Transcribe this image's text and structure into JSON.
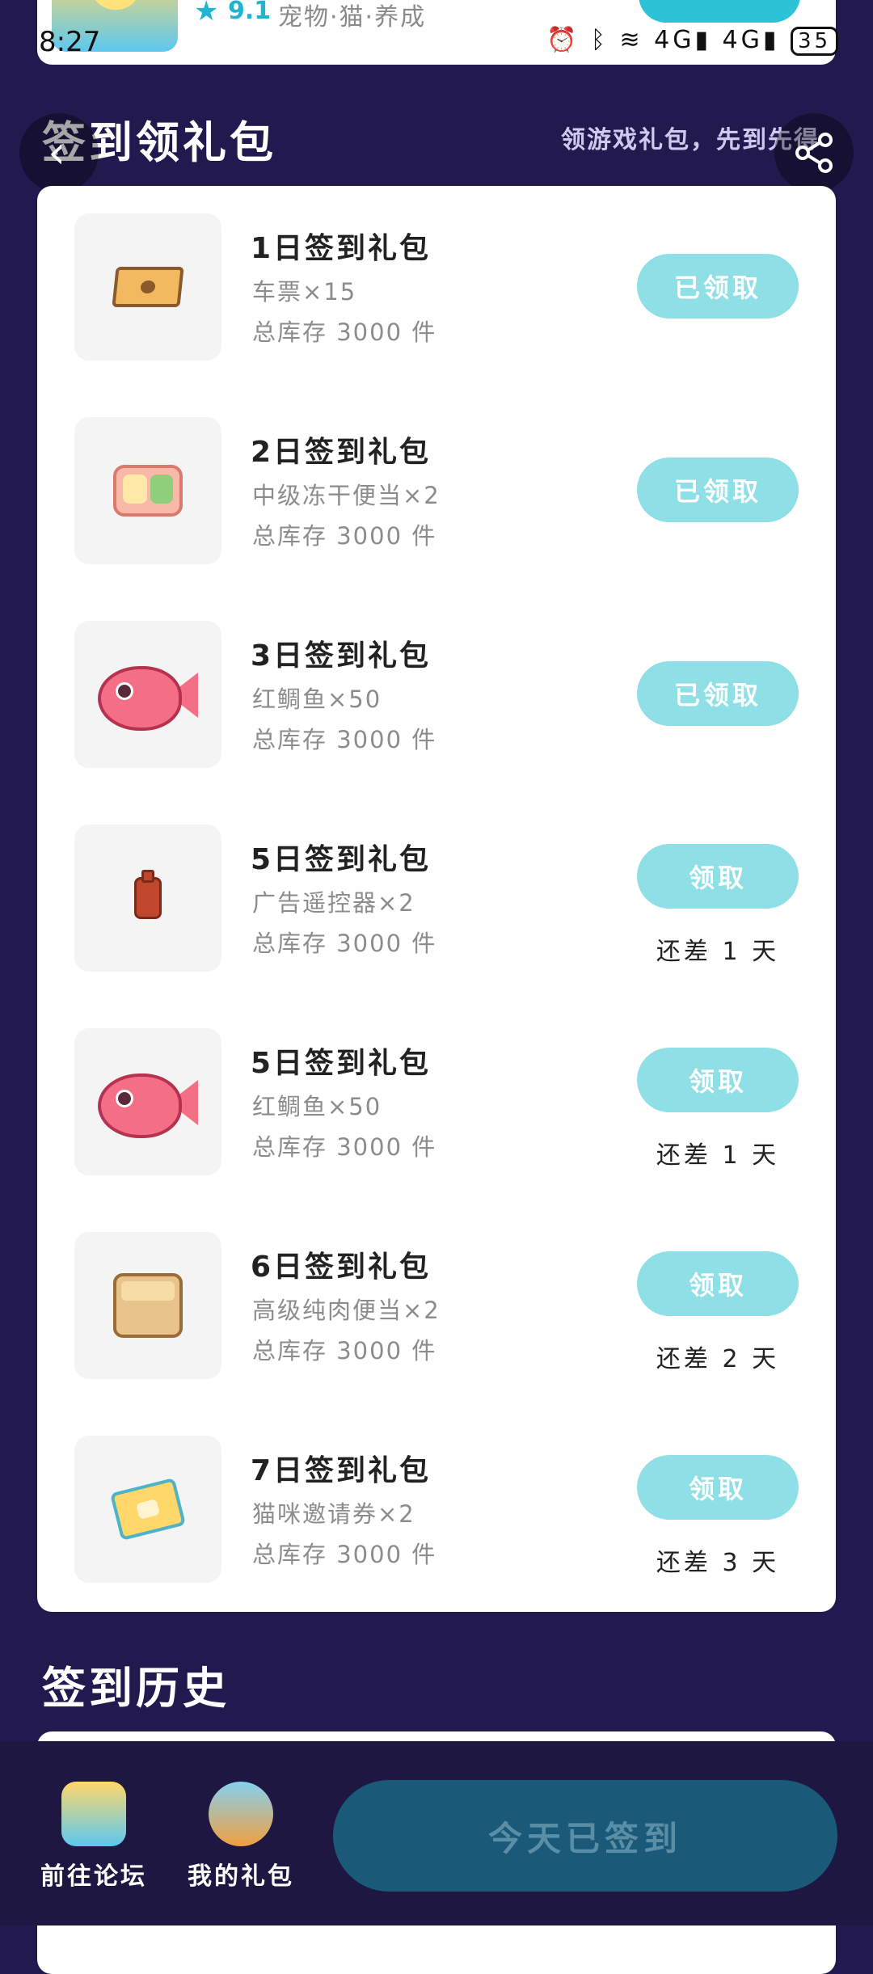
{
  "app": {
    "rating": "9.1",
    "tags": "宠物·猫·养成"
  },
  "status_bar": {
    "time": "8:27",
    "battery": "35",
    "signal_1": "4G",
    "signal_2": "4G"
  },
  "header": {
    "title": "签到领礼包",
    "hint": "领游戏礼包，先到先得"
  },
  "gifts": [
    {
      "title": "1日签到礼包",
      "item": "车票×15",
      "stock": "总库存 3000 件",
      "button": "已领取",
      "remain": "",
      "icon": "ticket-icon"
    },
    {
      "title": "2日签到礼包",
      "item": "中级冻干便当×2",
      "stock": "总库存 3000 件",
      "button": "已领取",
      "remain": "",
      "icon": "bento-icon"
    },
    {
      "title": "3日签到礼包",
      "item": "红鲷鱼×50",
      "stock": "总库存 3000 件",
      "button": "已领取",
      "remain": "",
      "icon": "fish-icon"
    },
    {
      "title": "5日签到礼包",
      "item": "广告遥控器×2",
      "stock": "总库存 3000 件",
      "button": "领取",
      "remain": "还差 1 天",
      "icon": "remote-icon"
    },
    {
      "title": "5日签到礼包",
      "item": "红鲷鱼×50",
      "stock": "总库存 3000 件",
      "button": "领取",
      "remain": "还差 1 天",
      "icon": "fish-icon"
    },
    {
      "title": "6日签到礼包",
      "item": "高级纯肉便当×2",
      "stock": "总库存 3000 件",
      "button": "领取",
      "remain": "还差 2 天",
      "icon": "bento-box-icon"
    },
    {
      "title": "7日签到礼包",
      "item": "猫咪邀请券×2",
      "stock": "总库存 3000 件",
      "button": "领取",
      "remain": "还差 3 天",
      "icon": "coupon-icon"
    }
  ],
  "history": {
    "title": "签到历史"
  },
  "bottom_nav": {
    "forum_label": "前往论坛",
    "my_gifts_label": "我的礼包",
    "checkin_label": "今天已签到"
  },
  "colors": {
    "background": "#221a4e",
    "claim_button": "#8fdfe7",
    "checkin_button": "#1a5a78",
    "accent": "#1fb5d0"
  }
}
